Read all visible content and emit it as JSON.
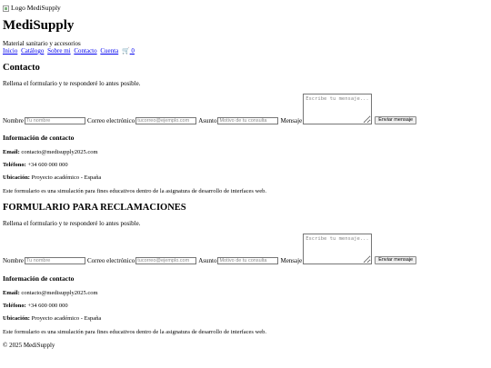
{
  "header": {
    "logo_alt": "Logo MediSupply",
    "brand": "MediSupply",
    "tagline": "Material sanitario y accesorios",
    "nav": [
      "Inicio",
      "Catálogo",
      "Sobre mi",
      "Contacto",
      "Cuenta"
    ],
    "cart_icon": "cart-icon",
    "cart_glyph": "🛒",
    "cart_count": "0"
  },
  "sections": [
    {
      "title": "Contacto",
      "intro": "Rellena el formulario y te responderé lo antes posible.",
      "form": {
        "name_label": "Nombre",
        "name_placeholder": "Tu nombre",
        "email_label": "Correo electrónico",
        "email_placeholder": "tucorreo@ejemplo.com",
        "subject_label": "Asunto",
        "subject_placeholder": "Motivo de tu consulta",
        "message_label": "Mensaje",
        "message_placeholder": "Escribe tu mensaje...",
        "submit_label": "Enviar mensaje"
      },
      "info": {
        "title": "Información de contacto",
        "email_label": "Email:",
        "email_value": "contacto@medisupply2025.com",
        "phone_label": "Teléfono:",
        "phone_value": "+34 600 000 000",
        "location_label": "Ubicación:",
        "location_value": "Proyecto académico - España"
      },
      "note": "Este formulario es una simulación para fines educativos dentro de la asignatura de desarrollo de interfaces web."
    },
    {
      "title": "FORMULARIO PARA RECLAMACIONES",
      "intro": "Rellena el formulario y te responderé lo antes posible.",
      "form": {
        "name_label": "Nombre",
        "name_placeholder": "Tu nombre",
        "email_label": "Correo electrónico",
        "email_placeholder": "tucorreo@ejemplo.com",
        "subject_label": "Asunto",
        "subject_placeholder": "Motivo de tu consulta",
        "message_label": "Mensaje",
        "message_placeholder": "Escribe tu mensaje...",
        "submit_label": "Enviar mensaje"
      },
      "info": {
        "title": "Información de contacto",
        "email_label": "Email:",
        "email_value": "contacto@medisupply2025.com",
        "phone_label": "Teléfono:",
        "phone_value": "+34 600 000 000",
        "location_label": "Ubicación:",
        "location_value": "Proyecto académico - España"
      },
      "note": "Este formulario es una simulación para fines educativos dentro de la asignatura de desarrollo de interfaces web."
    }
  ],
  "footer": {
    "copyright": "© 2025 MediSupply"
  }
}
